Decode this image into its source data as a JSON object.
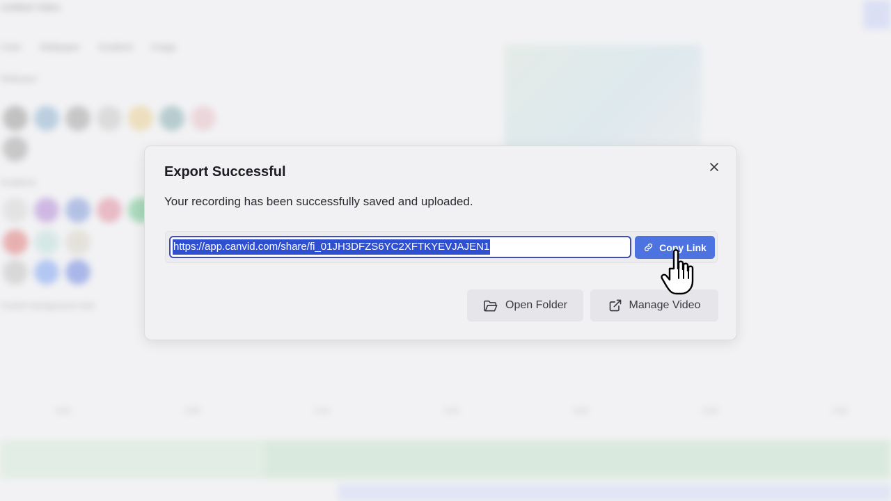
{
  "background": {
    "title": "Untitled Video",
    "tabs": [
      "Color",
      "Wallpaper",
      "Gradient",
      "Image"
    ],
    "section_wallpaper": "Wallpaper",
    "section_gradient": "Gradients",
    "section_custom": "Custom background color",
    "timeline_ticks": [
      "0:00",
      "0:05",
      "0:10",
      "0:15",
      "0:20",
      "0:25",
      "0:30"
    ]
  },
  "dialog": {
    "title": "Export Successful",
    "message": "Your recording has been successfully saved and uploaded.",
    "share_link": "https://app.canvid.com/share/fi_01JH3DFZS6YC2XFTKYEVJAJEN1",
    "copy_link_label": "Copy Link",
    "open_folder_label": "Open Folder",
    "manage_video_label": "Manage Video",
    "icons": {
      "close": "close-icon",
      "link": "link-icon",
      "folder": "folder-icon",
      "external": "external-link-icon",
      "cursor": "hand-pointer-icon"
    }
  },
  "colors": {
    "accent": "#4d73e1",
    "selection": "#2f4fd1",
    "focus_ring": "#3e4cc0"
  }
}
